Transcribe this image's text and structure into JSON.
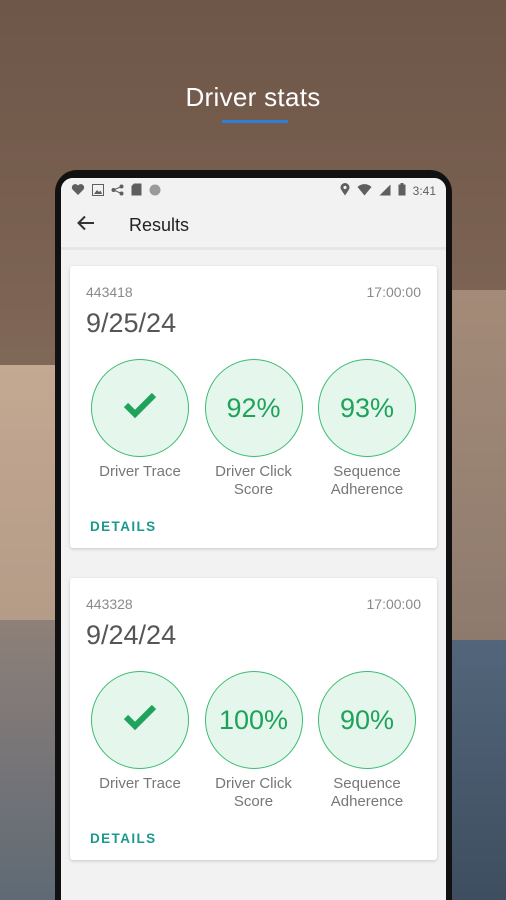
{
  "headline": "Driver stats",
  "colors": {
    "accent_blue": "#2f7fd6",
    "metric_green": "#1fa35a",
    "metric_fill": "#e5f7ec",
    "link_teal": "#1b9a8c"
  },
  "status_bar": {
    "time": "3:41",
    "left_icons": [
      "heart-icon",
      "image-icon",
      "share-icon",
      "sd-card-icon",
      "circle-icon"
    ],
    "right_icons": [
      "location-icon",
      "wifi-icon",
      "signal-icon",
      "battery-icon"
    ]
  },
  "app_bar": {
    "back_icon": "arrow-left-icon",
    "title": "Results"
  },
  "results": [
    {
      "id": "443418",
      "time": "17:00:00",
      "date": "9/25/24",
      "metrics": [
        {
          "label": "Driver Trace",
          "value": "✔",
          "icon": "check-icon"
        },
        {
          "label": "Driver Click Score",
          "value": "92%"
        },
        {
          "label": "Sequence Adherence",
          "value": "93%"
        }
      ],
      "details_label": "DETAILS"
    },
    {
      "id": "443328",
      "time": "17:00:00",
      "date": "9/24/24",
      "metrics": [
        {
          "label": "Driver Trace",
          "value": "✔",
          "icon": "check-icon"
        },
        {
          "label": "Driver Click Score",
          "value": "100%"
        },
        {
          "label": "Sequence Adherence",
          "value": "90%"
        }
      ],
      "details_label": "DETAILS"
    }
  ]
}
